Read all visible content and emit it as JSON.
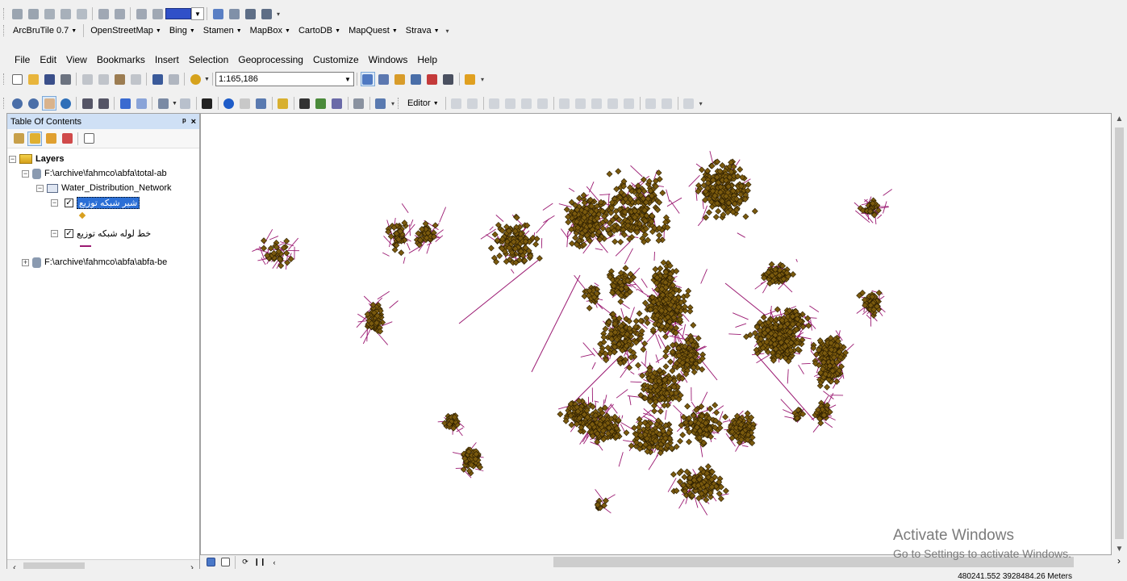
{
  "toolbars": {
    "tiles": {
      "arcbrutile": "ArcBruTile 0.7",
      "providers": [
        "OpenStreetMap",
        "Bing",
        "Stamen",
        "MapBox",
        "CartoDB",
        "MapQuest",
        "Strava"
      ]
    },
    "standard": {
      "scale": "1:165,186"
    },
    "editor": {
      "label": "Editor"
    }
  },
  "menubar": {
    "items": [
      "File",
      "Edit",
      "View",
      "Bookmarks",
      "Insert",
      "Selection",
      "Geoprocessing",
      "Customize",
      "Windows",
      "Help"
    ]
  },
  "toc": {
    "title": "Table Of Contents",
    "pin": "y",
    "close": "×",
    "root": "Layers",
    "nodes": {
      "group1": "F:\\archive\\fahmco\\abfa\\total-ab",
      "subgroup": "Water_Distribution_Network",
      "layer1": "شیر شبکه توزیع",
      "layer2": "خط لوله شبکه توزیع",
      "group2": "F:\\archive\\fahmco\\abfa\\abfa-be"
    }
  },
  "colors": {
    "point_fill": "#7a5a0e",
    "point_stroke": "#2a1c00",
    "line_color": "#9b1a72",
    "selection": "#2b6fd6"
  },
  "watermark": {
    "line1": "Activate Windows",
    "line2": "Go to Settings to activate Windows."
  },
  "status": {
    "coords": "480241.552  3928484.26 Meters"
  }
}
